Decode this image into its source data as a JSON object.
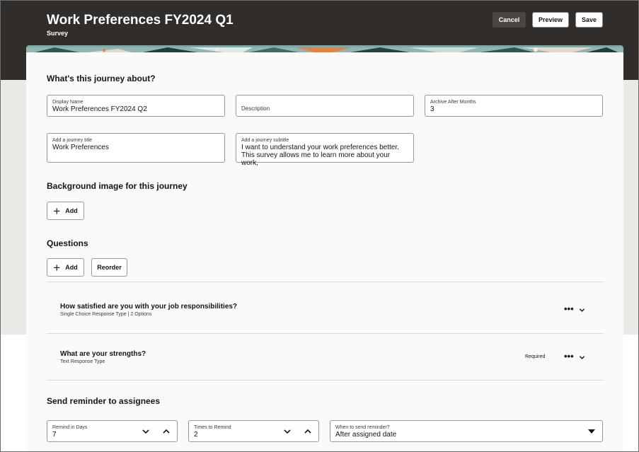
{
  "header": {
    "title": "Work Preferences FY2024 Q1",
    "subtitle": "Survey",
    "cancel_label": "Cancel",
    "preview_label": "Preview",
    "save_label": "Save"
  },
  "about": {
    "heading": "What's this journey about?",
    "display_name_label": "Display Name",
    "display_name_value": "Work Preferences FY2024 Q2",
    "description_placeholder": "Description",
    "archive_label": "Archive After Months",
    "archive_value": "3",
    "journey_title_label": "Add a journey title",
    "journey_title_value": "Work Preferences",
    "journey_subtitle_label": "Add a journey subtitle",
    "journey_subtitle_line1": "I want to understand your work preferences better.",
    "journey_subtitle_line2": "This survey allows me to learn more about your work,"
  },
  "background": {
    "heading": "Background image for this journey",
    "add_label": "Add"
  },
  "questions": {
    "heading": "Questions",
    "add_label": "Add",
    "reorder_label": "Reorder",
    "items": [
      {
        "title": "How satisfied are you with your job responsibilities?",
        "type": "Single Choice Response Type | 2 Options",
        "required": ""
      },
      {
        "title": "What are your strengths?",
        "type": "Text Response Type",
        "required": "Required"
      }
    ]
  },
  "reminder": {
    "heading": "Send reminder to assignees",
    "remind_days_label": "Remind in Days",
    "remind_days_value": "7",
    "times_label": "Times to Remind",
    "times_value": "2",
    "when_label": "When to send reminder?",
    "when_value": "After assigned date"
  },
  "colors": {
    "header_bg": "#312d2a",
    "card_bg": "#fbfaf8",
    "banner_teal": "#7fa9a6",
    "banner_orange": "#e9813b"
  }
}
